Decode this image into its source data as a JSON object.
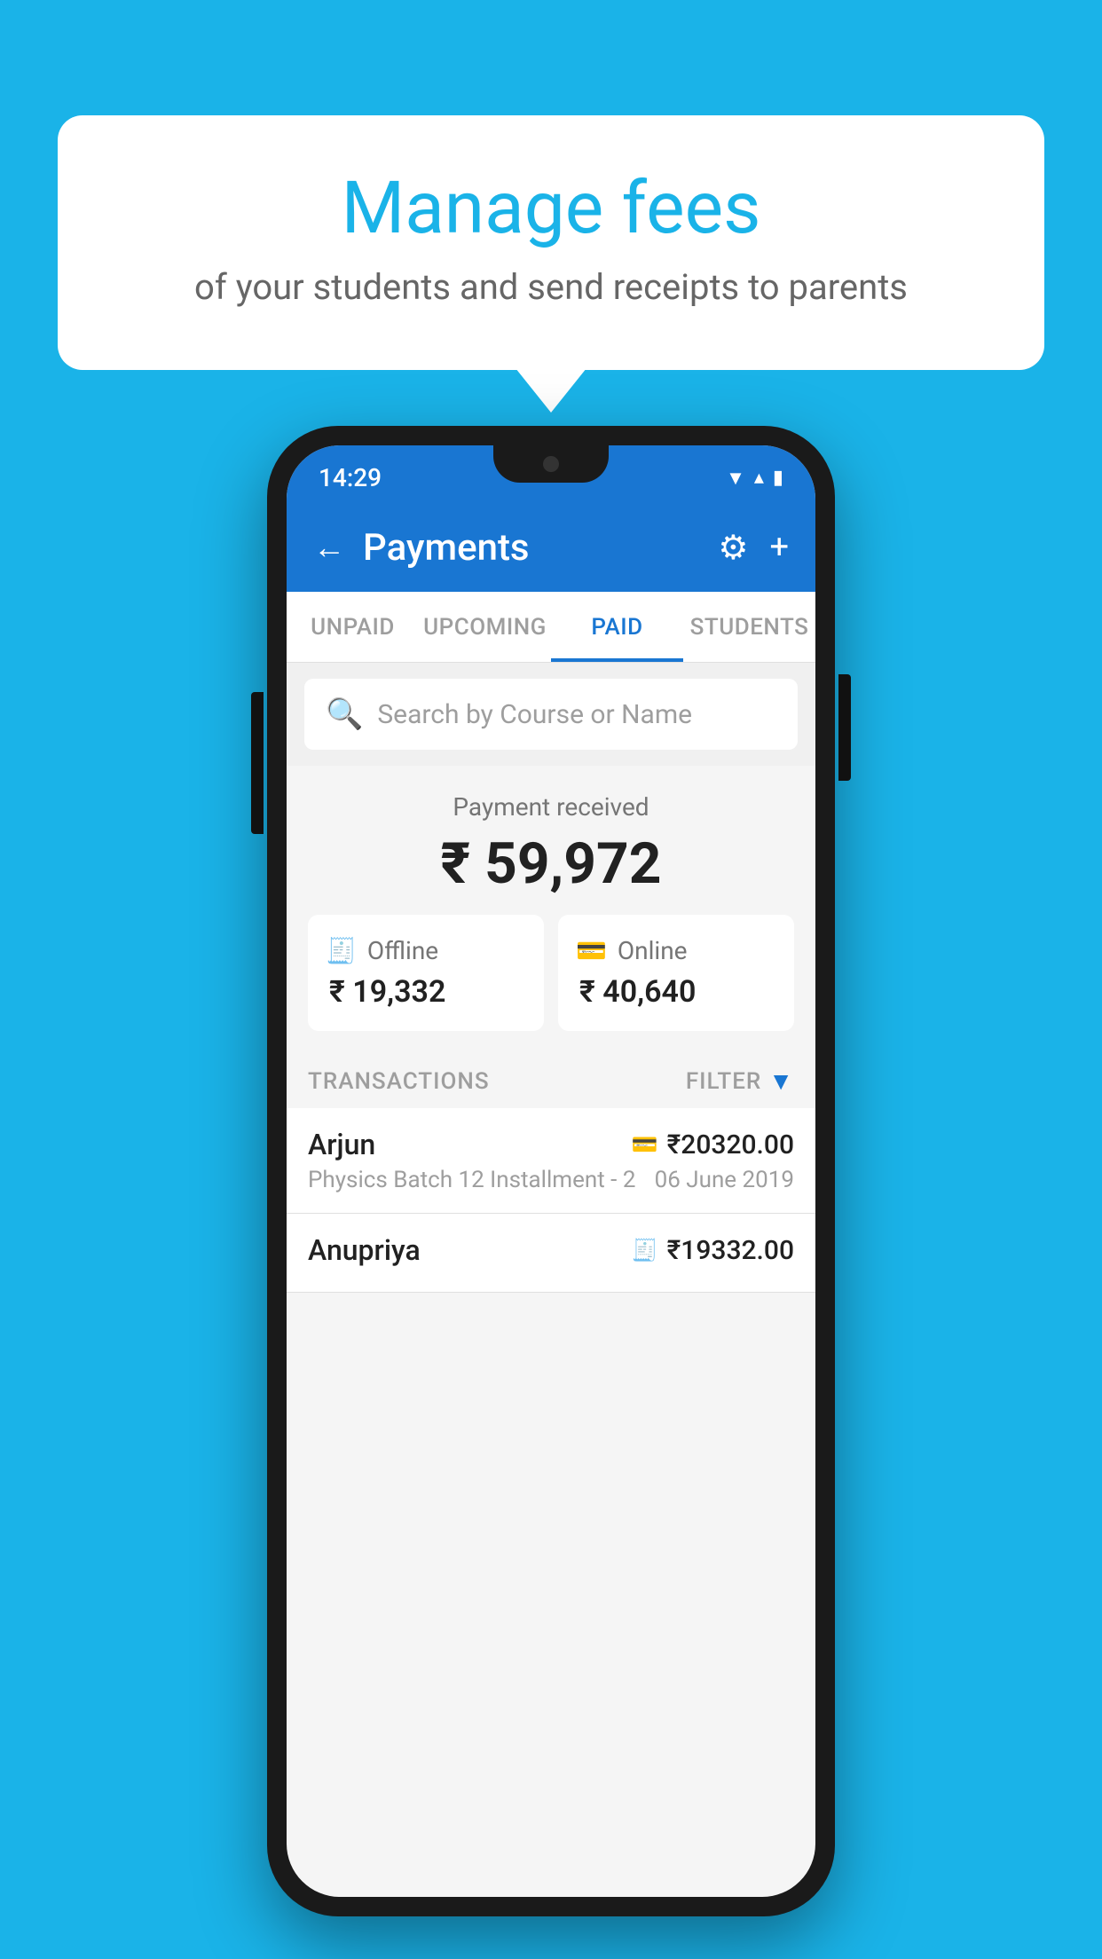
{
  "background_color": "#1ab3e8",
  "speech_bubble": {
    "title": "Manage fees",
    "subtitle": "of your students and send receipts to parents"
  },
  "status_bar": {
    "time": "14:29",
    "wifi": "▲",
    "signal": "▲",
    "battery": "▌"
  },
  "header": {
    "title": "Payments",
    "back_label": "←",
    "settings_label": "⚙",
    "add_label": "+"
  },
  "tabs": [
    {
      "label": "UNPAID",
      "active": false
    },
    {
      "label": "UPCOMING",
      "active": false
    },
    {
      "label": "PAID",
      "active": true
    },
    {
      "label": "STUDENTS",
      "active": false
    }
  ],
  "search": {
    "placeholder": "Search by Course or Name"
  },
  "payment_summary": {
    "label": "Payment received",
    "amount": "₹ 59,972",
    "offline": {
      "label": "Offline",
      "amount": "₹ 19,332"
    },
    "online": {
      "label": "Online",
      "amount": "₹ 40,640"
    }
  },
  "transactions": {
    "label": "TRANSACTIONS",
    "filter_label": "FILTER",
    "items": [
      {
        "name": "Arjun",
        "course": "Physics Batch 12 Installment - 2",
        "amount": "₹20320.00",
        "date": "06 June 2019",
        "type": "online"
      },
      {
        "name": "Anupriya",
        "course": "",
        "amount": "₹19332.00",
        "date": "",
        "type": "offline"
      }
    ]
  }
}
